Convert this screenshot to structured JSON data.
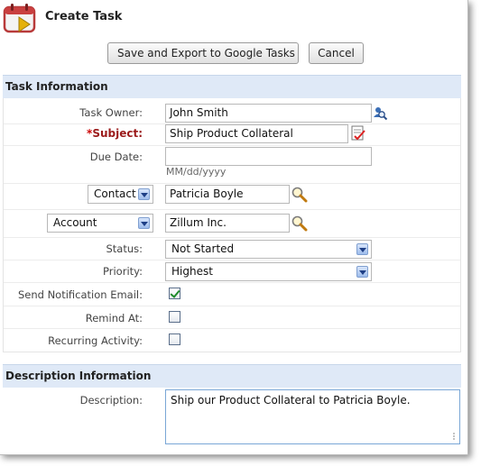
{
  "header": {
    "title": "Create Task",
    "icon": "calendar-task-icon"
  },
  "toolbar": {
    "save_label": "Save and Export to Google Tasks",
    "cancel_label": "Cancel"
  },
  "sections": {
    "task_info": "Task Information",
    "description_info": "Description Information"
  },
  "fields": {
    "task_owner": {
      "label": "Task Owner:",
      "value": "John Smith",
      "icon": "user-lookup-icon"
    },
    "subject": {
      "required_marker": "*",
      "label": "Subject:",
      "value": "Ship Product Collateral",
      "icon": "subject-list-icon"
    },
    "due_date": {
      "label": "Due Date:",
      "value": "",
      "format_hint": "MM/dd/yyyy"
    },
    "contact": {
      "type_selected": "Contact",
      "value": "Patricia Boyle",
      "icon": "search-icon"
    },
    "account": {
      "type_selected": "Account",
      "value": "Zillum Inc.",
      "icon": "search-icon"
    },
    "status": {
      "label": "Status:",
      "selected": "Not Started"
    },
    "priority": {
      "label": "Priority:",
      "selected": "Highest"
    },
    "send_notification": {
      "label": "Send Notification Email:",
      "checked": true
    },
    "remind_at": {
      "label": "Remind At:",
      "checked": false
    },
    "recurring": {
      "label": "Recurring Activity:",
      "checked": false
    }
  },
  "description": {
    "label": "Description:",
    "value": "Ship our Product Collateral to Patricia Boyle."
  },
  "colors": {
    "section_header_bg": "#dfe9f7",
    "required_label": "#9b1b1b",
    "focus_border": "#7aa7d6"
  }
}
